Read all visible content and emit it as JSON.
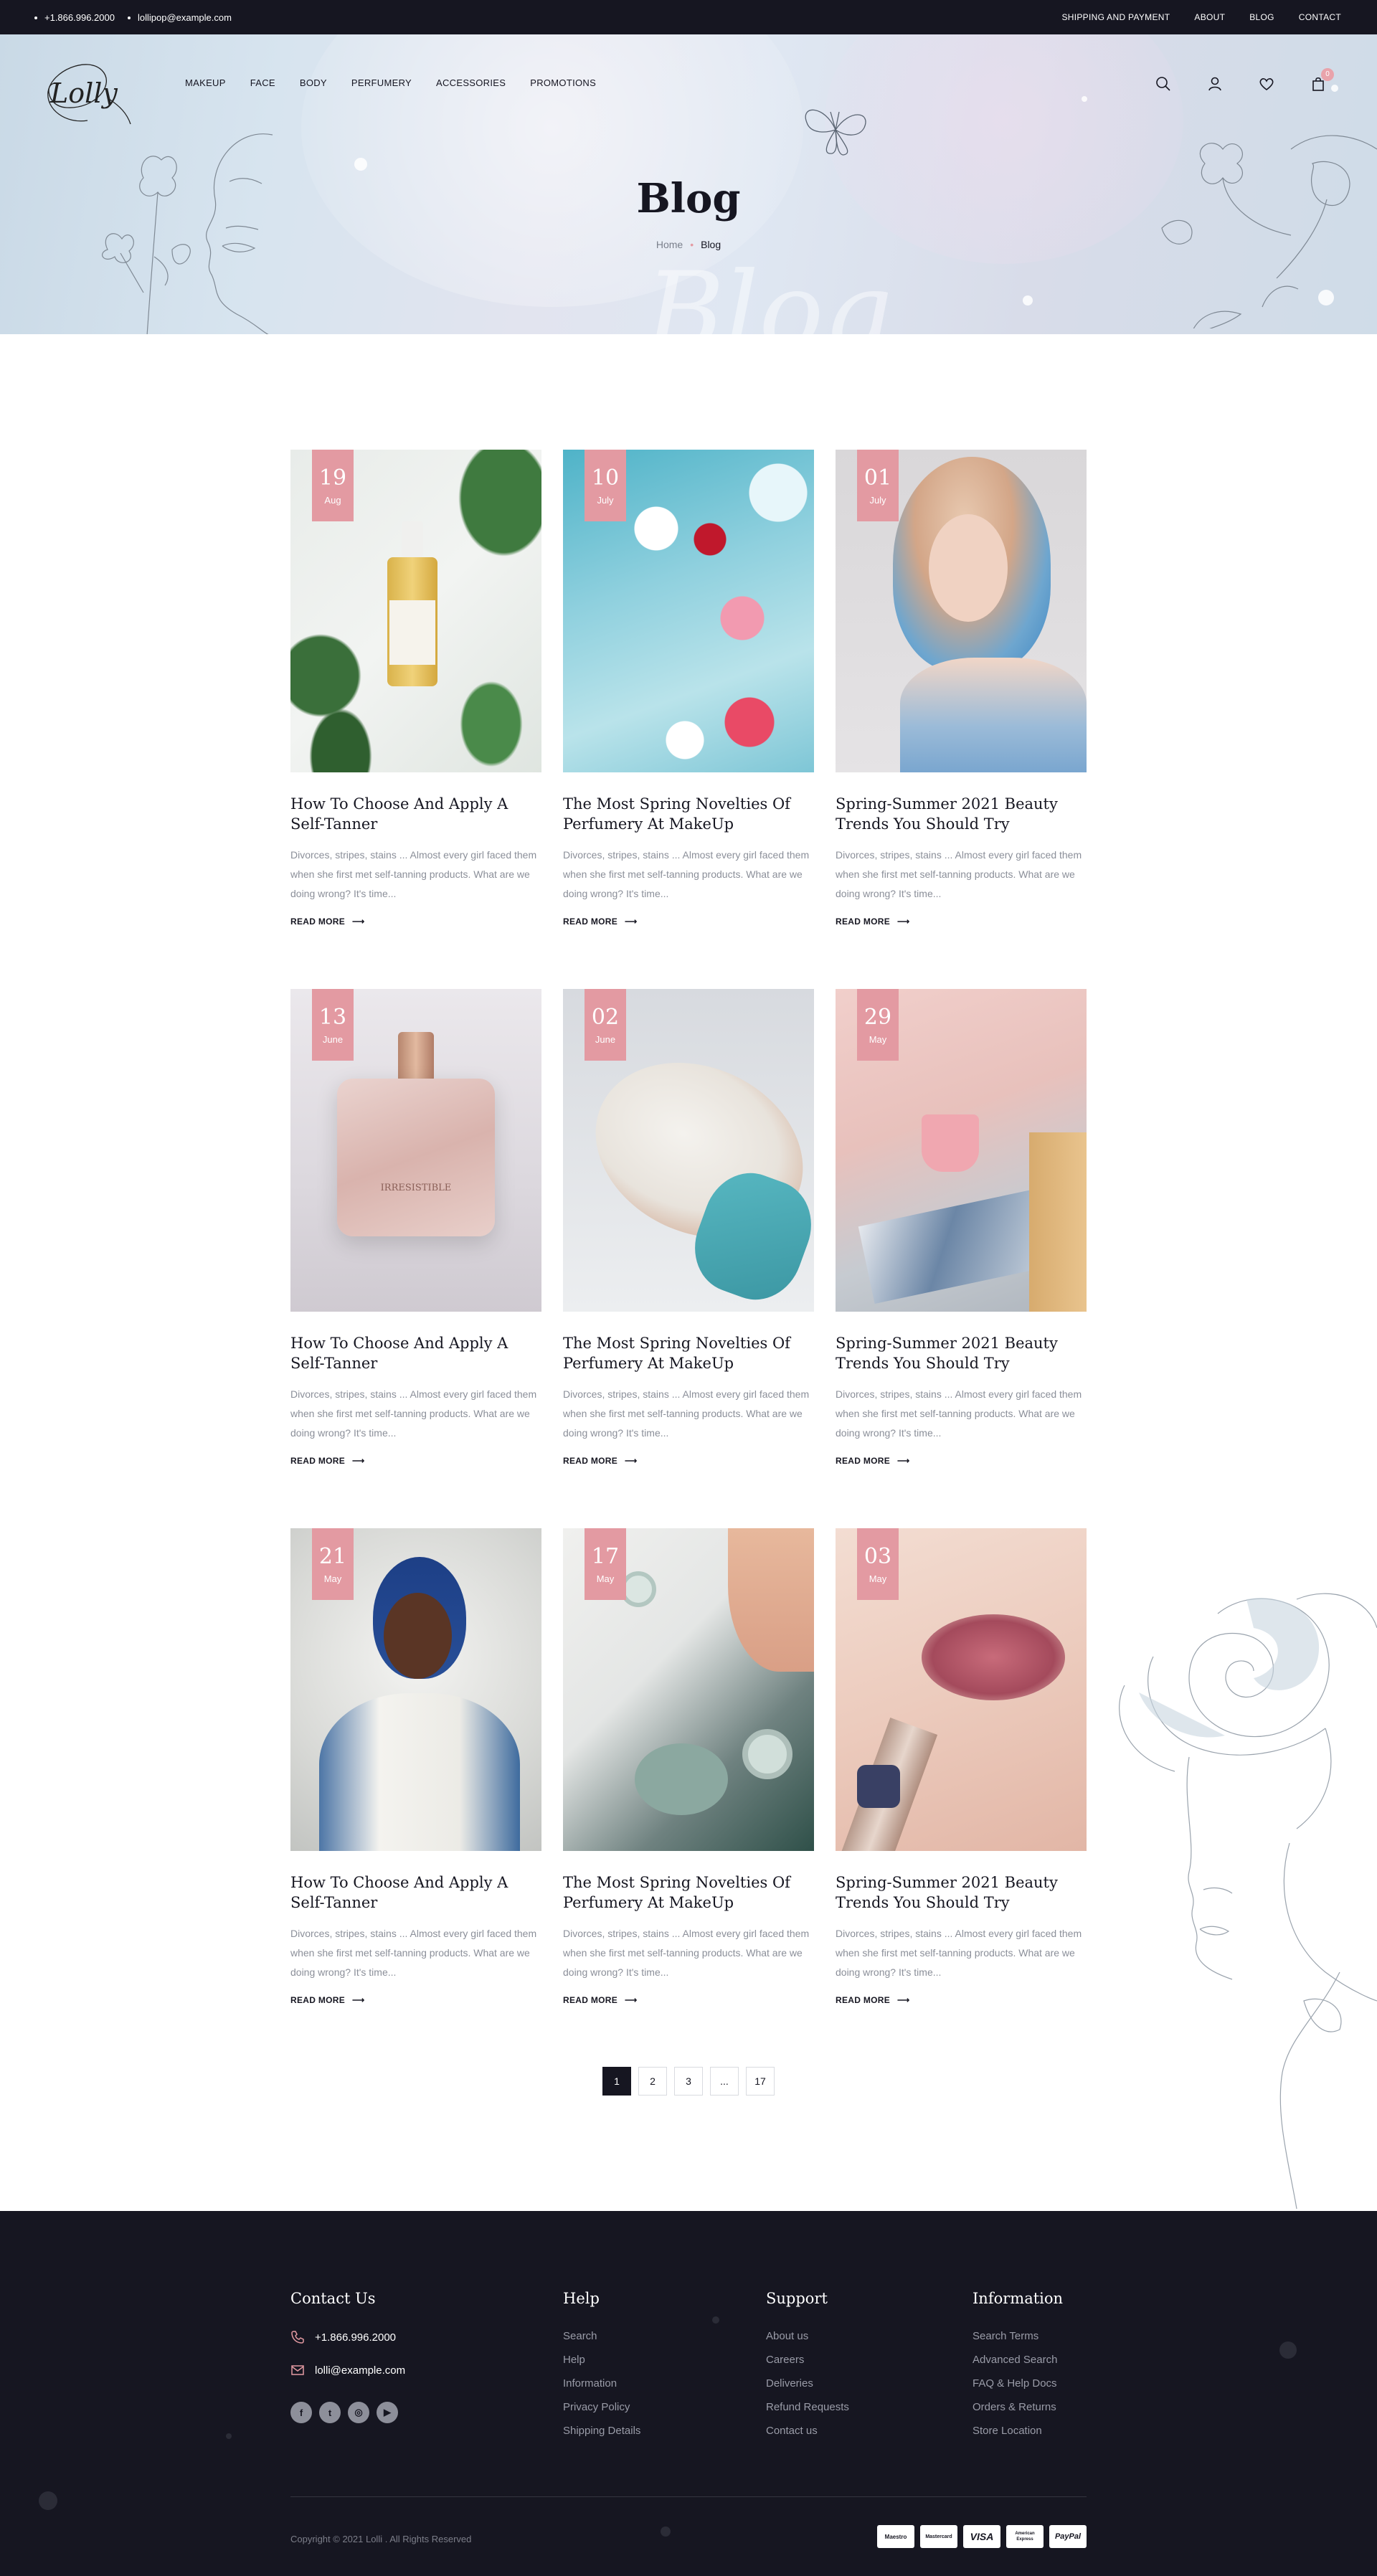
{
  "topbar": {
    "phone": "+1.866.996.2000",
    "email": "lollipop@example.com",
    "links": [
      "SHIPPING AND PAYMENT",
      "ABOUT",
      "BLOG",
      "CONTACT"
    ]
  },
  "header": {
    "logo_text": "Lolly",
    "nav": [
      "MAKEUP",
      "FACE",
      "BODY",
      "PERFUMERY",
      "ACCESSORIES",
      "PROMOTIONS"
    ],
    "cart_count": "0",
    "icons": [
      "search-icon",
      "user-icon",
      "heart-icon",
      "bag-icon"
    ]
  },
  "hero": {
    "title": "Blog",
    "watermark": "Blog",
    "breadcrumb": {
      "home": "Home",
      "current": "Blog"
    }
  },
  "posts": [
    {
      "day": "19",
      "month": "Aug",
      "title": "How To Choose And Apply A Self-Tanner",
      "excerpt": "Divorces, stripes, stains ... Almost every girl faced them when she first met self-tanning products. What are we doing wrong? It's time...",
      "more": "READ MORE"
    },
    {
      "day": "10",
      "month": "July",
      "title": "The Most Spring Novelties Of Perfumery At MakeUp",
      "excerpt": "Divorces, stripes, stains ... Almost every girl faced them when she first met self-tanning products. What are we doing wrong? It's time...",
      "more": "READ MORE"
    },
    {
      "day": "01",
      "month": "July",
      "title": "Spring-Summer 2021 Beauty Trends You Should Try",
      "excerpt": "Divorces, stripes, stains ... Almost every girl faced them when she first met self-tanning products. What are we doing wrong? It's time...",
      "more": "READ MORE"
    },
    {
      "day": "13",
      "month": "June",
      "title": "How To Choose And Apply A Self-Tanner",
      "excerpt": "Divorces, stripes, stains ... Almost every girl faced them when she first met self-tanning products. What are we doing wrong? It's time...",
      "more": "READ MORE"
    },
    {
      "day": "02",
      "month": "June",
      "title": "The Most Spring Novelties Of Perfumery At MakeUp",
      "excerpt": "Divorces, stripes, stains ... Almost every girl faced them when she first met self-tanning products. What are we doing wrong? It's time...",
      "more": "READ MORE"
    },
    {
      "day": "29",
      "month": "May",
      "title": "Spring-Summer 2021 Beauty Trends You Should Try",
      "excerpt": "Divorces, stripes, stains ... Almost every girl faced them when she first met self-tanning products. What are we doing wrong? It's time...",
      "more": "READ MORE"
    },
    {
      "day": "21",
      "month": "May",
      "title": "How To Choose And Apply A Self-Tanner",
      "excerpt": "Divorces, stripes, stains ... Almost every girl faced them when she first met self-tanning products. What are we doing wrong? It's time...",
      "more": "READ MORE"
    },
    {
      "day": "17",
      "month": "May",
      "title": "The Most Spring Novelties Of Perfumery At MakeUp",
      "excerpt": "Divorces, stripes, stains ... Almost every girl faced them when she first met self-tanning products. What are we doing wrong? It's time...",
      "more": "READ MORE"
    },
    {
      "day": "03",
      "month": "May",
      "title": "Spring-Summer 2021 Beauty Trends You Should Try",
      "excerpt": "Divorces, stripes, stains ... Almost every girl faced them when she first met self-tanning products. What are we doing wrong? It's time...",
      "more": "READ MORE"
    }
  ],
  "pagination": [
    "1",
    "2",
    "3",
    "...",
    "17"
  ],
  "footer": {
    "contact": {
      "heading": "Contact Us",
      "phone": "+1.866.996.2000",
      "email": "lolli@example.com"
    },
    "help": {
      "heading": "Help",
      "links": [
        "Search",
        "Help",
        "Information",
        "Privacy Policy",
        "Shipping Details"
      ]
    },
    "support": {
      "heading": "Support",
      "links": [
        "About us",
        "Careers",
        "Deliveries",
        "Refund Requests",
        "Contact us"
      ]
    },
    "information": {
      "heading": "Information",
      "links": [
        "Search Terms",
        "Advanced Search",
        "FAQ & Help Docs",
        "Orders & Returns",
        "Store Location"
      ]
    },
    "copyright": "Copyright © 2021 Lolli . All Rights Reserved",
    "payments": [
      "Maestro",
      "Mastercard",
      "VISA",
      "American Express",
      "PayPal"
    ]
  },
  "colors": {
    "accent": "#e39aa2",
    "dark": "#161621",
    "muted": "#8b8f99"
  }
}
